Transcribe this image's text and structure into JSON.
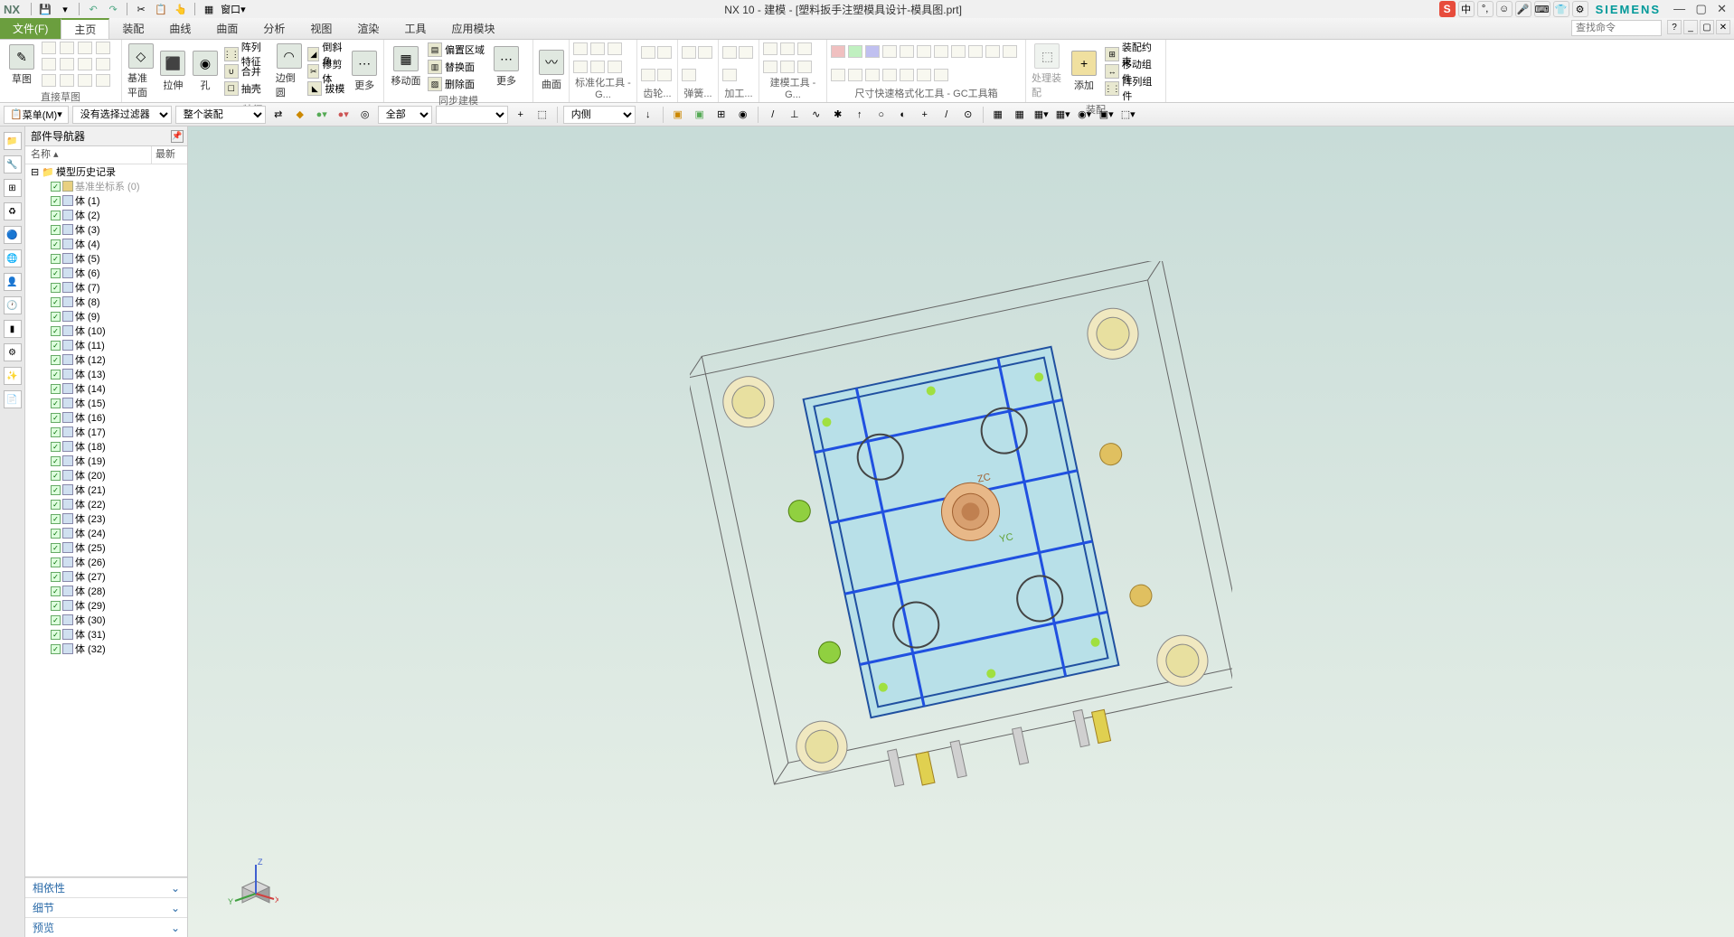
{
  "app": {
    "logo": "NX",
    "title": "NX 10 - 建模 - [塑料扳手注塑模具设计-模具图.prt]",
    "brand": "SIEMENS",
    "window_menu": "窗口"
  },
  "ime": {
    "s": "S",
    "ch": "中"
  },
  "menu": {
    "file": "文件(F)",
    "tabs": [
      "主页",
      "装配",
      "曲线",
      "曲面",
      "分析",
      "视图",
      "渲染",
      "工具",
      "应用模块"
    ],
    "active": 0,
    "search_placeholder": "查找命令"
  },
  "ribbon": {
    "groups": {
      "sketch": {
        "label": "直接草图",
        "btn": "草图"
      },
      "feature": {
        "label": "特征",
        "datum": "基准平面",
        "extrude": "拉伸",
        "hole": "孔",
        "pattern": "阵列特征",
        "unite": "合并",
        "shell": "抽壳",
        "edge": "边倒圆",
        "chamfer": "倒斜角",
        "trim": "修剪体",
        "draft": "拔模",
        "more": "更多"
      },
      "sync": {
        "label": "同步建模",
        "move_face": "移动面",
        "replace_region": "偏置区域",
        "replace_face": "替换面",
        "delete_face": "删除面",
        "more": "更多"
      },
      "surface": {
        "label": "曲面",
        "btn": "曲面"
      },
      "std": {
        "label": "标准化工具 - G..."
      },
      "gear": {
        "label": "齿轮..."
      },
      "spring": {
        "label": "弹簧..."
      },
      "mach": {
        "label": "加工..."
      },
      "model": {
        "label": "建模工具 - G..."
      },
      "dim": {
        "label": "尺寸快速格式化工具 - GC工具箱"
      },
      "asm": {
        "label": "装配",
        "process": "处理装配",
        "add": "添加",
        "constraint": "装配约束",
        "move_comp": "移动组件",
        "array_comp": "阵列组件"
      }
    }
  },
  "optbar": {
    "menu": "菜单(M)",
    "filter_sel": "没有选择过滤器",
    "assembly_sel": "整个装配",
    "scope_sel": "全部",
    "inner_sel": "内侧"
  },
  "nav": {
    "title": "部件导航器",
    "col_name": "名称",
    "col_new": "最新",
    "root": "模型历史记录",
    "csys": "基准坐标系 (0)",
    "body_prefix": "体",
    "body_count": 32,
    "sections": {
      "depend": "相依性",
      "detail": "细节",
      "preview": "预览"
    }
  },
  "triad": {
    "x": "X",
    "y": "Y",
    "z": "Z"
  },
  "viewport": {
    "zc": "ZC",
    "yc": "YC"
  }
}
